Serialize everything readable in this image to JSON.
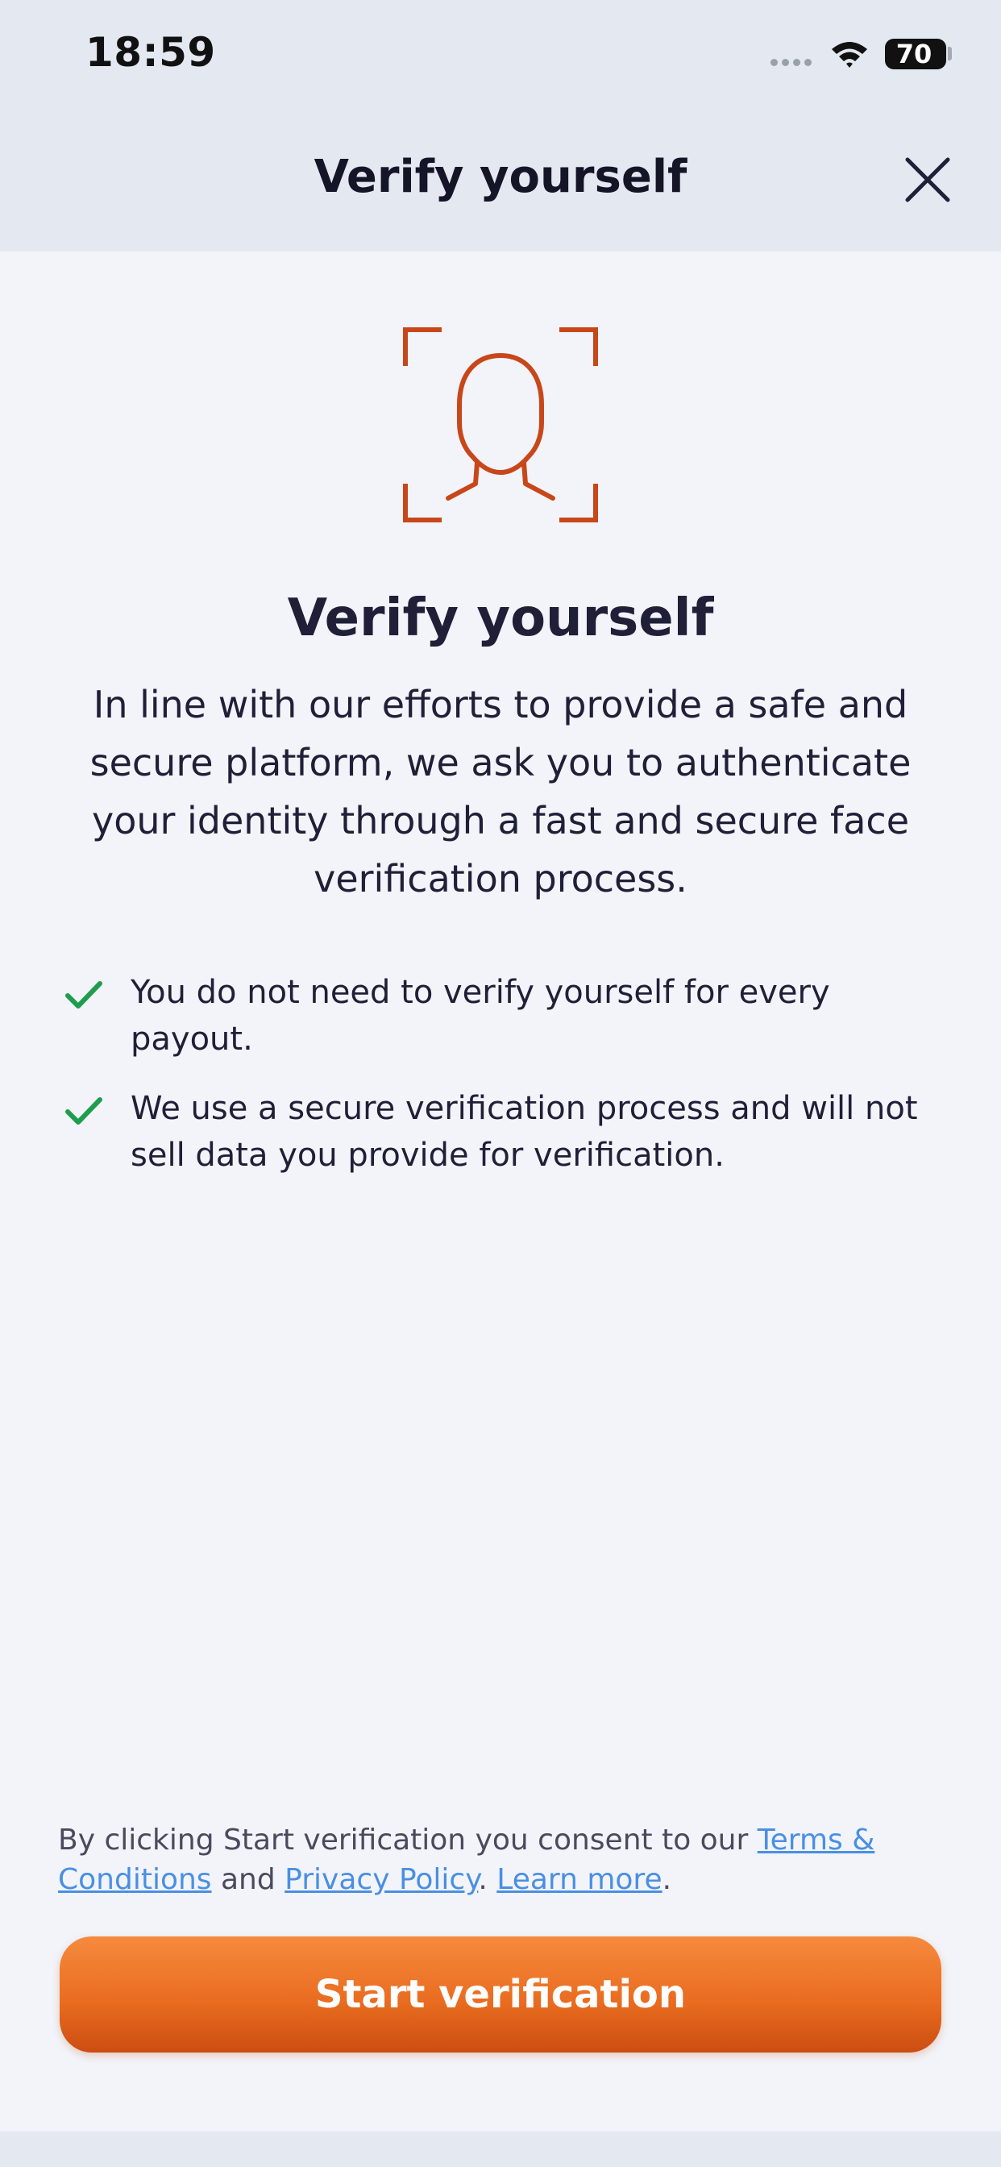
{
  "status_bar": {
    "time": "18:59",
    "battery": "70"
  },
  "nav": {
    "title": "Verify yourself",
    "close_icon": "close-icon"
  },
  "hero": {
    "icon": "face-scan-icon",
    "heading": "Verify yourself",
    "intro": "In line with our efforts to provide a safe and secure platform, we ask you to authenticate your identity through a fast and secure face verification process."
  },
  "bullets": [
    {
      "icon": "check-icon",
      "text": "You do not need to verify yourself for every payout."
    },
    {
      "icon": "check-icon",
      "text": "We use a secure verification process and will not sell data you provide for verification."
    }
  ],
  "consent": {
    "prefix": "By clicking Start verification you consent to our ",
    "terms_link": "Terms & Conditions",
    "and": " and ",
    "privacy_link": "Privacy Policy",
    "separator": ". ",
    "learn_more_link": "Learn more",
    "suffix": "."
  },
  "cta": {
    "label": "Start verification"
  },
  "colors": {
    "accent": "#ea6d21",
    "icon_orange": "#c8471a",
    "check_green": "#1f9d4f",
    "link_blue": "#4a8fe3",
    "header_bg": "#e3e8f1",
    "page_bg": "#f2f4f9"
  }
}
